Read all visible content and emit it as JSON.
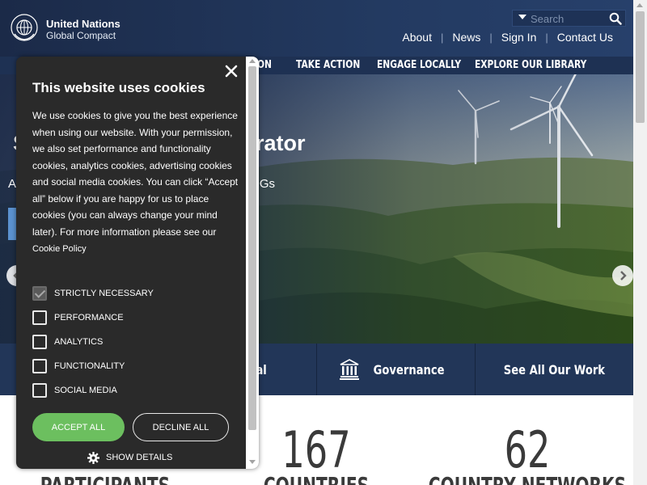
{
  "header": {
    "brand_line1": "United Nations",
    "brand_line2": "Global Compact",
    "logo_icon": "un-emblem-icon",
    "search": {
      "placeholder": "Search",
      "icon": "search-icon"
    },
    "top_links": [
      "About",
      "News",
      "Sign In",
      "Contact Us"
    ]
  },
  "main_nav": {
    "items": [
      "ON",
      "TAKE ACTION",
      "ENGAGE LOCALLY",
      "EXPLORE OUR LIBRARY"
    ]
  },
  "hero": {
    "title_fragment": "S",
    "title_suffix": "rator",
    "subtitle_fragment": "A",
    "subtitle_suffix": "DGs",
    "prev_icon": "chevron-left-icon",
    "next_icon": "chevron-right-icon"
  },
  "work_bar": {
    "items": [
      "ial",
      "Governance",
      "See All Our Work"
    ],
    "governance_icon": "building-icon"
  },
  "stats": [
    {
      "number": "",
      "label": "PARTICIPANTS"
    },
    {
      "number": "167",
      "label": "COUNTRIES"
    },
    {
      "number": "62",
      "label": "COUNTRY NETWORKS"
    }
  ],
  "cookie_dialog": {
    "title": "This website uses cookies",
    "body": "We use cookies to give you the best experience when using our website.  With your permission, we also set performance and functionality cookies, analytics cookies, advertising cookies and social media cookies.  You can click “Accept all” below if you are happy for us to place cookies (you can always change your mind later).  For more information please see our ",
    "policy_link": "Cookie Policy",
    "options": [
      {
        "label": "STRICTLY NECESSARY",
        "checked": true
      },
      {
        "label": "PERFORMANCE",
        "checked": false
      },
      {
        "label": "ANALYTICS",
        "checked": false
      },
      {
        "label": "FUNCTIONALITY",
        "checked": false
      },
      {
        "label": "SOCIAL MEDIA",
        "checked": false
      }
    ],
    "accept_label": "ACCEPT ALL",
    "decline_label": "DECLINE ALL",
    "details_label": "SHOW DETAILS",
    "close_icon": "close-icon",
    "gear_icon": "gear-icon"
  },
  "colors": {
    "header_bg": "#233a61",
    "nav_bg": "#1e3153",
    "dialog_bg": "#2a2a2a",
    "accept_green": "#6cbf5f",
    "stat_text": "#3a3a3a"
  }
}
